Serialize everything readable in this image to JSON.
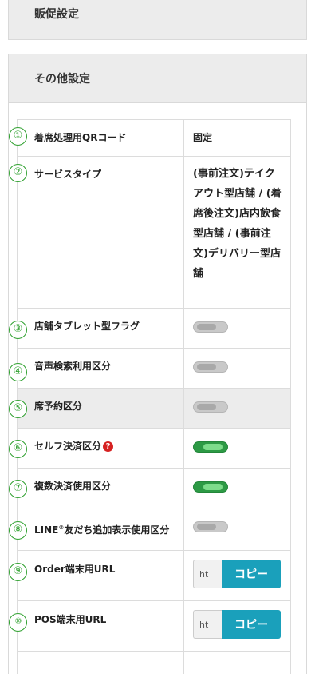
{
  "sections": {
    "promo_title": "販促設定",
    "other_title": "その他設定"
  },
  "rows": [
    {
      "no": "①",
      "label": "着席処理用QRコード",
      "value": "固定"
    },
    {
      "no": "②",
      "label": "サービスタイプ",
      "value": "(事前注文)テイクアウト型店舗 / (着席後注文)店内飲食型店舗 / (事前注文)デリバリー型店舗"
    },
    {
      "no": "③",
      "label": "店舗タブレット型フラグ",
      "toggle": "off"
    },
    {
      "no": "④",
      "label": "音声検索利用区分",
      "toggle": "off"
    },
    {
      "no": "⑤",
      "label": "席予約区分",
      "toggle": "off"
    },
    {
      "no": "⑥",
      "label": "セルフ決済区分",
      "help_icon": "?",
      "toggle": "on"
    },
    {
      "no": "⑦",
      "label": "複数決済使用区分",
      "toggle": "on"
    },
    {
      "no": "⑧",
      "label_before": "LINE",
      "label_mark": "®",
      "label_after": "友だち追加表示使用区分",
      "toggle": "off"
    },
    {
      "no": "⑨",
      "label": "Order端末用URL",
      "url_value": "ht",
      "button": "コピー"
    },
    {
      "no": "⑩",
      "label": "POS端末用URL",
      "url_value": "ht",
      "button": "コピー"
    }
  ],
  "colors": {
    "toggle_on": "#2d9a45",
    "toggle_off": "#c9c9c9",
    "copy_button": "#1aa0bb",
    "number_badge": "#2ea02e",
    "help_icon": "#d62121"
  }
}
